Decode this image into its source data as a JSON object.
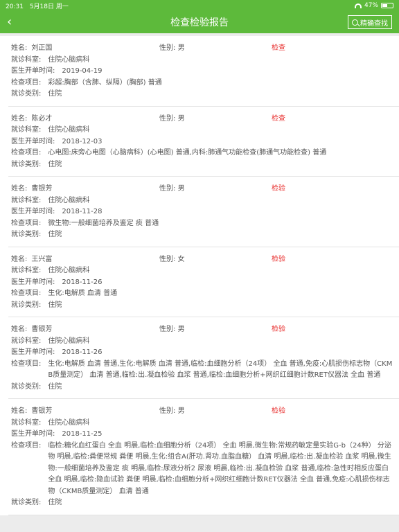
{
  "status_bar": {
    "time": "20:31",
    "date": "5月18日 周一",
    "battery": "47%",
    "battery_level": 0.47
  },
  "nav": {
    "back_icon": "‹",
    "title": "检查检验报告",
    "search_label": "精确查找"
  },
  "labels": {
    "name": "姓名:",
    "gender": "性别:",
    "dept": "就诊科室:",
    "time": "医生开单时间:",
    "items": "检查项目:",
    "category": "就诊类别:"
  },
  "records": [
    {
      "name": "刘正国",
      "gender": "男",
      "type": "检查",
      "dept": "住院心脑病科",
      "time": "2019-04-19",
      "items": "彩超:胸部（含肺、纵隔）(胸部) 普通",
      "category": "住院"
    },
    {
      "name": "陈必才",
      "gender": "男",
      "type": "检查",
      "dept": "住院心脑病科",
      "time": "2018-12-03",
      "items": "心电图:床旁心电图（心脑病科）(心电图) 普通,内科:肺通气功能检查(肺通气功能检查) 普通",
      "category": "住院"
    },
    {
      "name": "曹银芳",
      "gender": "男",
      "type": "检验",
      "dept": "住院心脑病科",
      "time": "2018-11-28",
      "items": "微生物:一般细菌培养及鉴定 痰 普通",
      "category": "住院"
    },
    {
      "name": "王兴富",
      "gender": "女",
      "type": "检验",
      "dept": "住院心脑病科",
      "time": "2018-11-26",
      "items": "生化:电解质 血清 普通",
      "category": "住院"
    },
    {
      "name": "曹银芳",
      "gender": "男",
      "type": "检验",
      "dept": "住院心脑病科",
      "time": "2018-11-26",
      "items": "生化:电解质 血清 普通,生化:电解质 血清 普通,临检:血细胞分析（24项） 全血 普通,免疫:心肌损伤标志物（CKMB质量测定） 血清 普通,临检:出.凝血检验 血浆 普通,临检:血细胞分析+网织红细胞计数RET仪器法 全血 普通",
      "category": "住院"
    },
    {
      "name": "曹银芳",
      "gender": "男",
      "type": "检验",
      "dept": "住院心脑病科",
      "time": "2018-11-25",
      "items": "临检:糖化血红蛋白 全血 明晨,临检:血细胞分析（24项） 全血 明晨,微生物:常规药敏定量实验G-b（24种） 分泌物 明晨,临检:粪便常规 粪便 明晨,生化:组合A(肝功.肾功.血脂血糖） 血清 明晨,临检:出.凝血检验 血浆 明晨,微生物:一般细菌培养及鉴定 痰 明晨,临检:尿液分析2 尿液 明晨,临检:出.凝血检验 血浆 普通,临检:急性时相反应蛋白 全血 明晨,临检:隐血试验 粪便 明晨,临检:血细胞分析+网织红细胞计数RET仪器法 全血 普通,免疫:心肌损伤标志物（CKMB质量测定） 血清 普通",
      "category": "住院"
    }
  ]
}
